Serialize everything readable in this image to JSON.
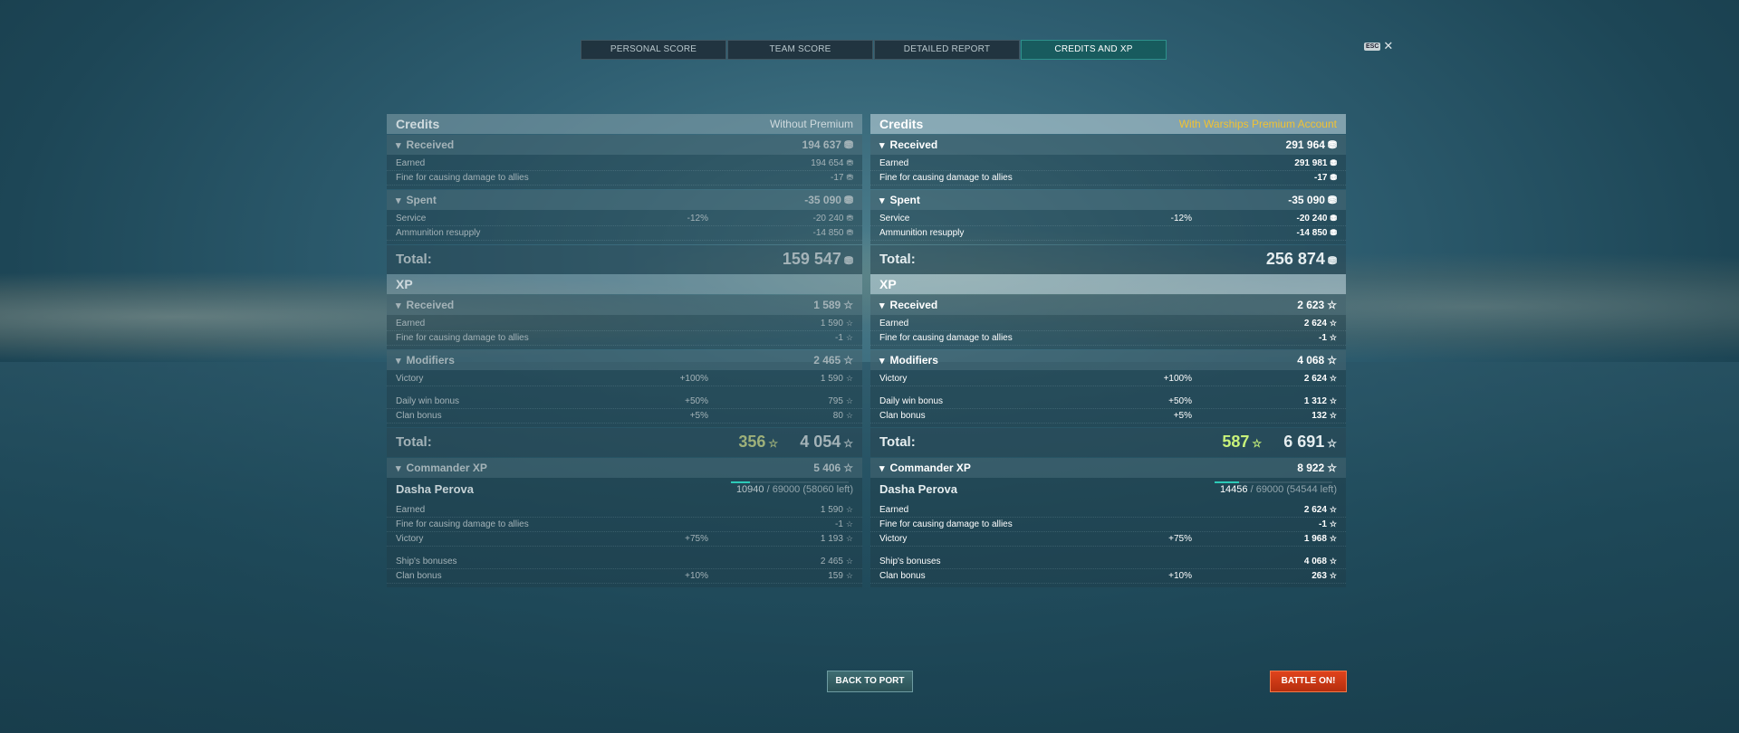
{
  "tabs": [
    "PERSONAL SCORE",
    "TEAM SCORE",
    "DETAILED REPORT",
    "CREDITS AND XP"
  ],
  "active_tab": "CREDITS AND XP",
  "esc_label": "ESC",
  "close_glyph": "✕",
  "credit_icon": "credit-coin-icon",
  "xp_icon": "star-icon",
  "left": {
    "credits_title": "Credits",
    "credits_sub": "Without Premium",
    "credits_received": {
      "label": "Received",
      "value": "194 637"
    },
    "credits_earned": {
      "label": "Earned",
      "value": "194 654"
    },
    "credits_fine": {
      "label": "Fine for causing damage to allies",
      "value": "-17"
    },
    "credits_spent": {
      "label": "Spent",
      "value": "-35 090"
    },
    "credits_service": {
      "label": "Service",
      "mod": "-12%",
      "value": "-20 240"
    },
    "credits_ammo": {
      "label": "Ammunition resupply",
      "value": "-14 850"
    },
    "credits_total": {
      "label": "Total:",
      "value": "159 547"
    },
    "xp_title": "XP",
    "xp_received": {
      "label": "Received",
      "value": "1 589"
    },
    "xp_earned": {
      "label": "Earned",
      "value": "1 590"
    },
    "xp_fine": {
      "label": "Fine for causing damage to allies",
      "value": "-1"
    },
    "xp_modifiers": {
      "label": "Modifiers",
      "value": "2 465"
    },
    "xp_victory": {
      "label": "Victory",
      "mod": "+100%",
      "value": "1 590"
    },
    "xp_daily": {
      "label": "Daily win bonus",
      "mod": "+50%",
      "value": "795"
    },
    "xp_clan": {
      "label": "Clan bonus",
      "mod": "+5%",
      "value": "80"
    },
    "xp_total": {
      "label": "Total:",
      "free": "356",
      "value": "4 054"
    },
    "cmd_head": {
      "label": "Commander XP",
      "value": "5 406"
    },
    "cmd_name": "Dasha Perova",
    "cmd_progress": {
      "current": "10940",
      "rest": " / 69000 (58060 left)",
      "fraction": 0.1586
    },
    "cmd_earned": {
      "label": "Earned",
      "value": "1 590"
    },
    "cmd_fine": {
      "label": "Fine for causing damage to allies",
      "value": "-1"
    },
    "cmd_victory": {
      "label": "Victory",
      "mod": "+75%",
      "value": "1 193"
    },
    "cmd_ship": {
      "label": "Ship's bonuses",
      "value": "2 465"
    },
    "cmd_clan": {
      "label": "Clan bonus",
      "mod": "+10%",
      "value": "159"
    }
  },
  "right": {
    "credits_title": "Credits",
    "credits_sub": "With Warships Premium Account",
    "credits_received": {
      "label": "Received",
      "value": "291 964"
    },
    "credits_earned": {
      "label": "Earned",
      "value": "291 981"
    },
    "credits_fine": {
      "label": "Fine for causing damage to allies",
      "value": "-17"
    },
    "credits_spent": {
      "label": "Spent",
      "value": "-35 090"
    },
    "credits_service": {
      "label": "Service",
      "mod": "-12%",
      "value": "-20 240"
    },
    "credits_ammo": {
      "label": "Ammunition resupply",
      "value": "-14 850"
    },
    "credits_total": {
      "label": "Total:",
      "value": "256 874"
    },
    "xp_title": "XP",
    "xp_received": {
      "label": "Received",
      "value": "2 623"
    },
    "xp_earned": {
      "label": "Earned",
      "value": "2 624"
    },
    "xp_fine": {
      "label": "Fine for causing damage to allies",
      "value": "-1"
    },
    "xp_modifiers": {
      "label": "Modifiers",
      "value": "4 068"
    },
    "xp_victory": {
      "label": "Victory",
      "mod": "+100%",
      "value": "2 624"
    },
    "xp_daily": {
      "label": "Daily win bonus",
      "mod": "+50%",
      "value": "1 312"
    },
    "xp_clan": {
      "label": "Clan bonus",
      "mod": "+5%",
      "value": "132"
    },
    "xp_total": {
      "label": "Total:",
      "free": "587",
      "value": "6 691"
    },
    "cmd_head": {
      "label": "Commander XP",
      "value": "8 922"
    },
    "cmd_name": "Dasha Perova",
    "cmd_progress": {
      "current": "14456",
      "rest": " / 69000 (54544 left)",
      "fraction": 0.2095
    },
    "cmd_earned": {
      "label": "Earned",
      "value": "2 624"
    },
    "cmd_fine": {
      "label": "Fine for causing damage to allies",
      "value": "-1"
    },
    "cmd_victory": {
      "label": "Victory",
      "mod": "+75%",
      "value": "1 968"
    },
    "cmd_ship": {
      "label": "Ship's bonuses",
      "value": "4 068"
    },
    "cmd_clan": {
      "label": "Clan bonus",
      "mod": "+10%",
      "value": "263"
    }
  },
  "buttons": {
    "back": "BACK TO PORT",
    "battle": "BATTLE ON!"
  },
  "colors": {
    "accent": "#2ecbb8",
    "premium": "#f1c232",
    "battle": "#d63a17",
    "free_xp": "#c8f27a"
  }
}
